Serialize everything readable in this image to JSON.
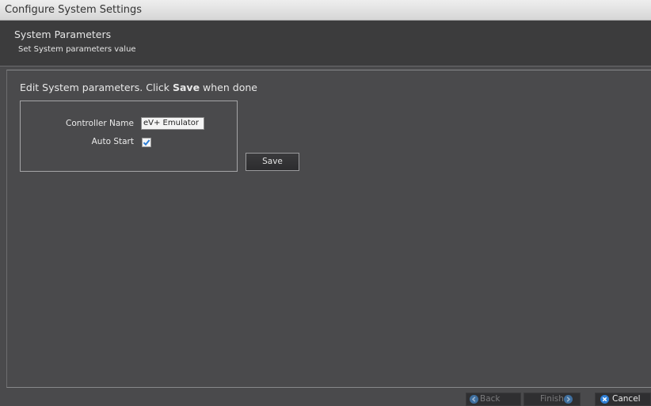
{
  "window": {
    "title": "Configure System Settings"
  },
  "header": {
    "title": "System Parameters",
    "subtitle": "Set System parameters value"
  },
  "main": {
    "instruction_prefix": "Edit System parameters. Click ",
    "instruction_bold": "Save",
    "instruction_suffix": " when done",
    "controller_name_label": "Controller Name",
    "controller_name_value": "eV+ Emulator",
    "auto_start_label": "Auto Start",
    "auto_start_checked": true,
    "save_label": "Save"
  },
  "footer": {
    "back_label": "Back",
    "finish_label": "Finish",
    "cancel_label": "Cancel",
    "back_enabled": false,
    "finish_enabled": false,
    "cancel_enabled": true
  },
  "colors": {
    "background": "#4a4a4c",
    "header_background": "#3c3c3d",
    "accent_blue": "#2f7fd6",
    "disabled_blue": "#3f6f9f"
  }
}
